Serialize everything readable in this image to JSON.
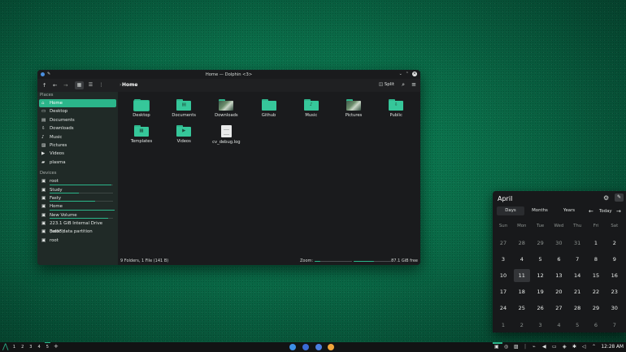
{
  "window": {
    "title": "Home — Dolphin <3>",
    "breadcrumb": "Home",
    "split_label": "Split",
    "statusbar": {
      "summary": "9 Folders, 1 File (141 B)",
      "zoom_label": "Zoom:",
      "zoom_level": 0.15,
      "disk_used_fraction": 0.55,
      "free_space": "87.1 GiB free"
    }
  },
  "sidebar": {
    "places_header": "Places",
    "places": [
      {
        "label": "Home",
        "icon": "home-icon",
        "active": true
      },
      {
        "label": "Desktop",
        "icon": "desktop-icon"
      },
      {
        "label": "Documents",
        "icon": "documents-icon"
      },
      {
        "label": "Downloads",
        "icon": "downloads-icon"
      },
      {
        "label": "Music",
        "icon": "music-icon"
      },
      {
        "label": "Pictures",
        "icon": "pictures-icon"
      },
      {
        "label": "Videos",
        "icon": "videos-icon"
      },
      {
        "label": "plasma",
        "icon": "folder-icon"
      }
    ],
    "devices_header": "Devices",
    "devices": [
      {
        "label": "root",
        "usage": 0.95
      },
      {
        "label": "Study",
        "usage": 0.45
      },
      {
        "label": "Fasty",
        "usage": 0.7
      },
      {
        "label": "Home",
        "usage": 1.0
      },
      {
        "label": "New Volume",
        "usage": 0.9
      },
      {
        "label": "223.1 GiB Internal Drive (sdb3)",
        "usage": null
      },
      {
        "label": "Basic data partition",
        "usage": null
      },
      {
        "label": "root",
        "usage": null
      }
    ]
  },
  "files": [
    {
      "label": "Desktop",
      "kind": "folder",
      "emblem": "",
      "selected": true
    },
    {
      "label": "Documents",
      "kind": "folder",
      "emblem": "▤"
    },
    {
      "label": "Downloads",
      "kind": "photo-folder",
      "emblem": ""
    },
    {
      "label": "Github",
      "kind": "folder",
      "emblem": ""
    },
    {
      "label": "Music",
      "kind": "folder",
      "emblem": "♪"
    },
    {
      "label": "Pictures",
      "kind": "photo-folder",
      "emblem": ""
    },
    {
      "label": "Public",
      "kind": "folder",
      "emblem": "⇩"
    },
    {
      "label": "Templates",
      "kind": "folder",
      "emblem": "▦"
    },
    {
      "label": "Videos",
      "kind": "folder",
      "emblem": "▶"
    },
    {
      "label": "cv_debug.log",
      "kind": "file",
      "emblem": ""
    }
  ],
  "calendar": {
    "month": "April",
    "tabs": [
      "Days",
      "Months",
      "Years"
    ],
    "active_tab": "Days",
    "today_label": "Today",
    "weekdays": [
      "Sun",
      "Mon",
      "Tue",
      "Wed",
      "Thu",
      "Fri",
      "Sat"
    ],
    "weeks": [
      [
        [
          "27",
          true
        ],
        [
          "28",
          true
        ],
        [
          "29",
          true
        ],
        [
          "30",
          true
        ],
        [
          "31",
          true
        ],
        [
          "1",
          false
        ],
        [
          "2",
          false
        ]
      ],
      [
        [
          "3",
          false
        ],
        [
          "4",
          false
        ],
        [
          "5",
          false
        ],
        [
          "6",
          false
        ],
        [
          "7",
          false
        ],
        [
          "8",
          false
        ],
        [
          "9",
          false
        ]
      ],
      [
        [
          "10",
          false
        ],
        [
          "11",
          false
        ],
        [
          "12",
          false
        ],
        [
          "13",
          false
        ],
        [
          "14",
          false
        ],
        [
          "15",
          false
        ],
        [
          "16",
          false
        ]
      ],
      [
        [
          "17",
          false
        ],
        [
          "18",
          false
        ],
        [
          "19",
          false
        ],
        [
          "20",
          false
        ],
        [
          "21",
          false
        ],
        [
          "22",
          false
        ],
        [
          "23",
          false
        ]
      ],
      [
        [
          "24",
          false
        ],
        [
          "25",
          false
        ],
        [
          "26",
          false
        ],
        [
          "27",
          false
        ],
        [
          "28",
          false
        ],
        [
          "29",
          false
        ],
        [
          "30",
          false
        ]
      ],
      [
        [
          "1",
          true
        ],
        [
          "2",
          true
        ],
        [
          "3",
          true
        ],
        [
          "4",
          true
        ],
        [
          "5",
          true
        ],
        [
          "6",
          true
        ],
        [
          "7",
          true
        ]
      ]
    ],
    "today": "11"
  },
  "taskbar": {
    "workspaces": [
      "1",
      "2",
      "3",
      "4",
      "5"
    ],
    "active_workspace": "5",
    "add_label": "+",
    "clock": "12:28 AM"
  },
  "colors": {
    "accent": "#2bb58a",
    "folder": "#36c79a"
  }
}
